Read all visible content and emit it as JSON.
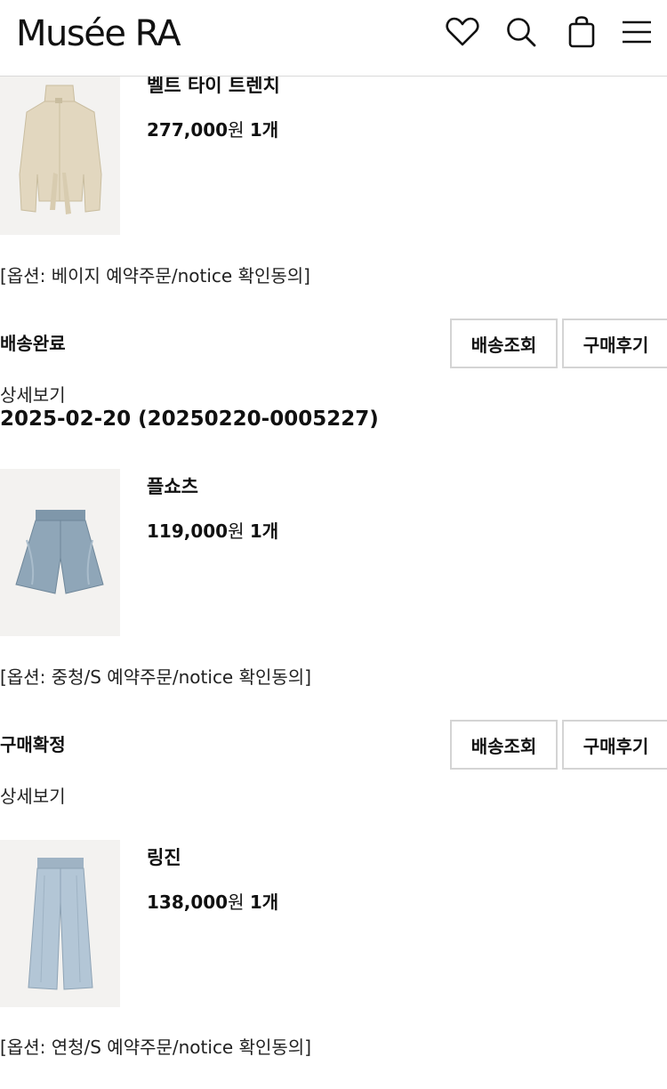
{
  "header": {
    "logo": "Musée RA",
    "icons": [
      "heart-icon",
      "search-icon",
      "shopping-bag-icon",
      "menu-icon"
    ]
  },
  "orders": [
    {
      "product_name": "벨트 타이 트렌치",
      "price": "277,000",
      "currency": "원",
      "quantity": "1개",
      "option": "[옵션: 베이지 예약주문/notice 확인동의]",
      "status": "배송완료",
      "button_track": "배송조회",
      "button_review": "구매후기",
      "detail_link": "상세보기"
    },
    {
      "order_date": "2025-02-20 (20250220-0005227)",
      "product_name": "플쇼츠",
      "price": "119,000",
      "currency": "원",
      "quantity": "1개",
      "option": "[옵션: 중청/S 예약주문/notice 확인동의]",
      "status": "구매확정",
      "button_track": "배송조회",
      "button_review": "구매후기",
      "detail_link": "상세보기"
    },
    {
      "product_name": "링진",
      "price": "138,000",
      "currency": "원",
      "quantity": "1개",
      "option": "[옵션: 연청/S 예약주문/notice 확인동의]"
    }
  ],
  "colors": {
    "text": "#111111",
    "border": "#d4d4d4",
    "thumb_bg": "#f3f2f0",
    "beige": "#e2d7bf",
    "denim_mid": "#8fa6b8",
    "denim_light": "#b3c6d6"
  }
}
